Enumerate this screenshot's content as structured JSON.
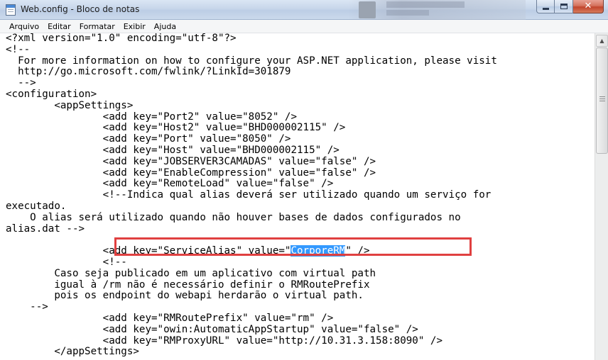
{
  "window": {
    "title": "Web.config - Bloco de notas",
    "close_glyph": "✕"
  },
  "menu": [
    "Arquivo",
    "Editar",
    "Formatar",
    "Exibir",
    "Ajuda"
  ],
  "editor": {
    "lines": [
      "<?xml version=\"1.0\" encoding=\"utf-8\"?>",
      "<!--",
      "  For more information on how to configure your ASP.NET application, please visit",
      "  http://go.microsoft.com/fwlink/?LinkId=301879",
      "  -->",
      "<configuration>",
      "        <appSettings>",
      "                <add key=\"Port2\" value=\"8052\" />",
      "                <add key=\"Host2\" value=\"BHD000002115\" />",
      "                <add key=\"Port\" value=\"8050\" />",
      "                <add key=\"Host\" value=\"BHD000002115\" />",
      "                <add key=\"JOBSERVER3CAMADAS\" value=\"false\" />",
      "                <add key=\"EnableCompression\" value=\"false\" />",
      "                <add key=\"RemoteLoad\" value=\"false\" />",
      "                <!--Indica qual alias deverá ser utilizado quando um serviço for",
      "executado.",
      "    O alias será utilizado quando não houver bases de dados configurados no",
      "alias.dat -->",
      "",
      "                <!--",
      "        Caso seja publicado em um aplicativo com virtual path",
      "        igual à /rm não é necessário definir o RMRoutePrefix",
      "        pois os endpoint do webapi herdarão o virtual path.",
      "    -->",
      "                <add key=\"RMRoutePrefix\" value=\"rm\" />",
      "                <add key=\"owin:AutomaticAppStartup\" value=\"false\" />",
      "                <add key=\"RMProxyURL\" value=\"http://10.31.3.158:8090\" />",
      "        </appSettings>"
    ],
    "highlighted_line": {
      "prefix": "                <add key=\"ServiceAlias\" value=\"",
      "selected": "CorporeRM",
      "suffix": "\" />"
    }
  },
  "icons": {
    "app": "notepad-icon",
    "minimize": "minimize-icon",
    "maximize": "maximize-icon",
    "close": "close-icon",
    "scroll_up": "scroll-up-arrow-icon"
  },
  "colors": {
    "selection": "#3399ff",
    "annotation_box": "#e04040"
  }
}
